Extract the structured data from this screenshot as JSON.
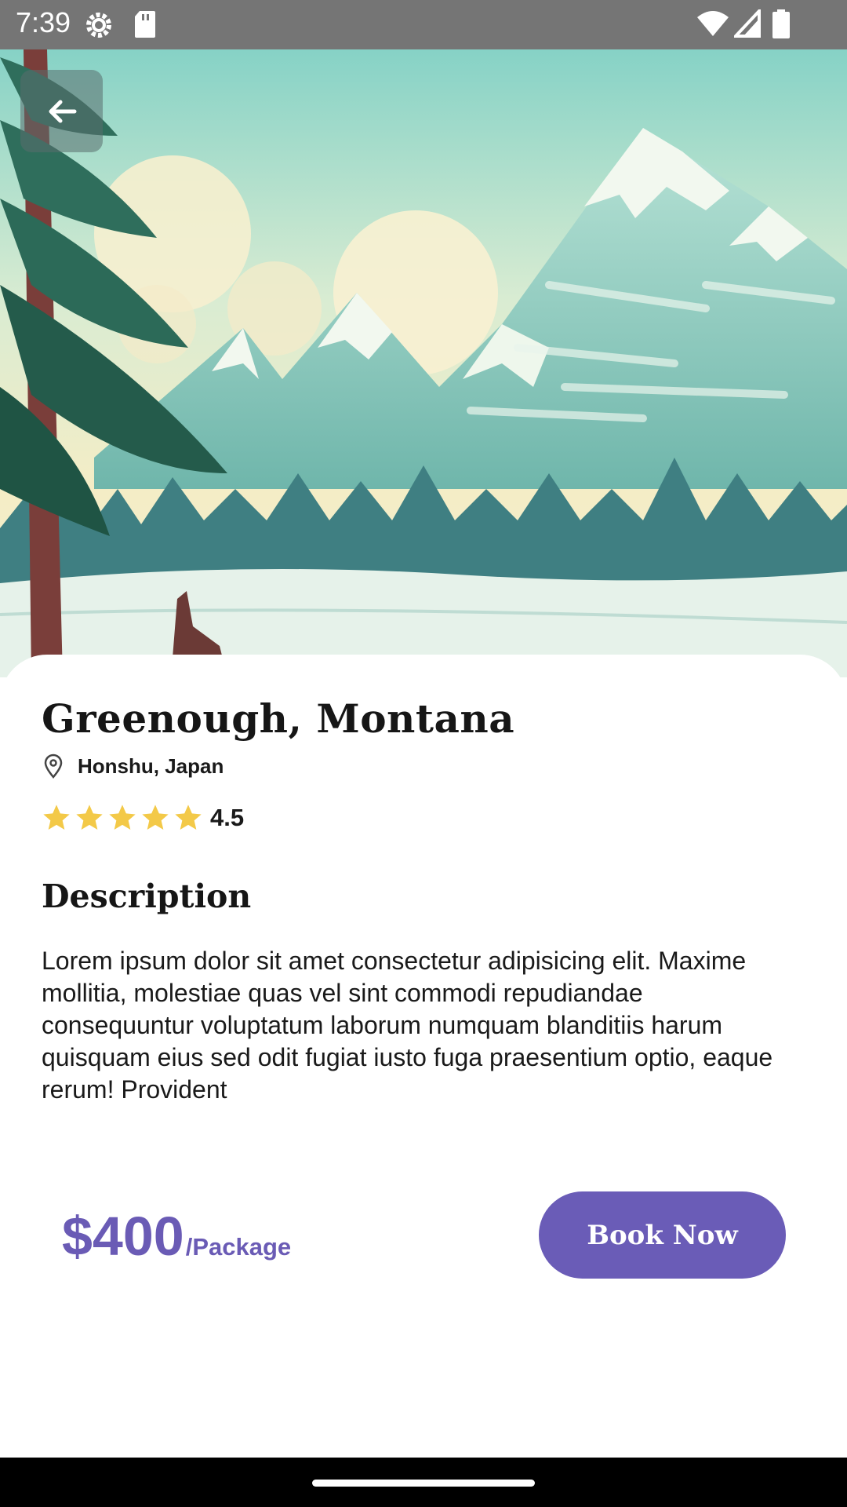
{
  "status_bar": {
    "time": "7:39",
    "icons": [
      "settings-icon",
      "sd-card-icon",
      "wifi-icon",
      "signal-icon",
      "battery-icon"
    ]
  },
  "hero": {
    "image": "mountain-landscape-illustration",
    "back_icon": "arrow-left-icon"
  },
  "place": {
    "title": "Greenough, Montana",
    "location_icon": "map-pin-icon",
    "location": "Honshu, Japan",
    "rating_stars": 5,
    "rating": "4.5"
  },
  "description": {
    "heading": "Description",
    "body": "Lorem ipsum dolor sit amet consectetur adipisicing elit. Maxime mollitia, molestiae quas vel sint commodi repudiandae consequuntur voluptatum laborum numquam blanditiis harum quisquam eius sed odit fugiat iusto fuga praesentium optio, eaque rerum! Provident"
  },
  "booking": {
    "price": "$400",
    "unit": "/Package",
    "book_label": "Book Now"
  },
  "colors": {
    "accent": "#6a5cb7",
    "star": "#f3c948",
    "status_bar": "#757575"
  }
}
